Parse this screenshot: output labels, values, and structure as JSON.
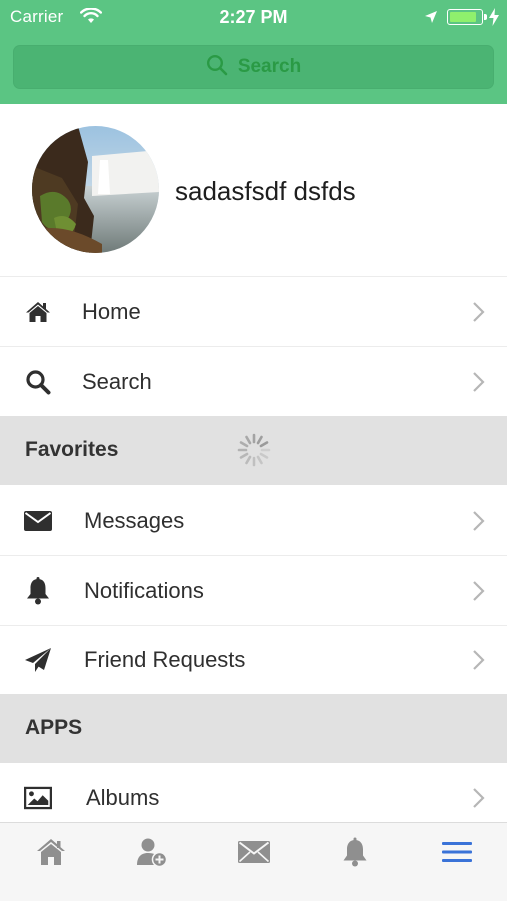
{
  "status_bar": {
    "carrier": "Carrier",
    "time": "2:27 PM",
    "battery_level": 0.9
  },
  "search": {
    "label": "Search",
    "icon": "search-icon"
  },
  "profile": {
    "name": "sadasfsdf dsfds",
    "avatar": "waterfall-landscape-photo"
  },
  "menu": {
    "home": "Home",
    "search": "Search",
    "favorites_header": "Favorites",
    "messages": "Messages",
    "notifications": "Notifications",
    "friend_requests": "Friend Requests",
    "apps_header": "APPS",
    "albums": "Albums"
  },
  "tabs": [
    "home-icon",
    "add-friend-icon",
    "mail-icon",
    "bell-icon",
    "menu-icon"
  ],
  "colors": {
    "header_green": "#5bc583",
    "search_field": "#4bb473",
    "search_text": "#2a9a45",
    "active_tab": "#3a73d8",
    "inactive_tab": "#8f8f8f"
  }
}
